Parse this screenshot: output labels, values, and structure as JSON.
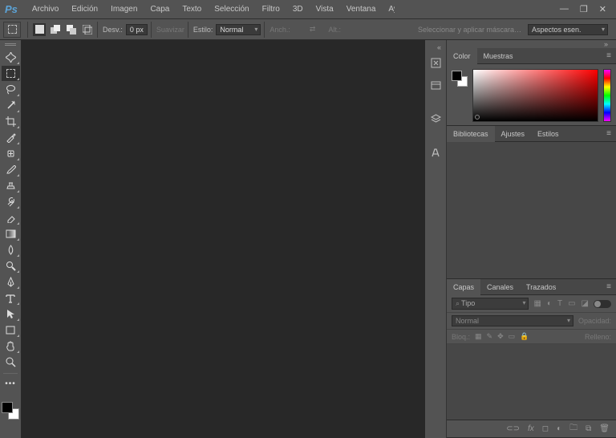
{
  "app": {
    "logo": "Ps"
  },
  "menu": [
    "Archivo",
    "Edición",
    "Imagen",
    "Capa",
    "Texto",
    "Selección",
    "Filtro",
    "3D",
    "Vista",
    "Ventana",
    "Ayuda"
  ],
  "win": {
    "min": "—",
    "max": "❐",
    "close": "✕"
  },
  "opt": {
    "desv": "Desv.:",
    "desv_val": "0 px",
    "suavizar": "Suavizar",
    "estilo": "Estilo:",
    "estilo_val": "Normal",
    "anch": "Anch.:",
    "alt": "Alt.:",
    "swap": "⇄",
    "refine": "Seleccionar y aplicar máscara…",
    "aspect": "Aspectos esen."
  },
  "colorPanel": {
    "tabs": [
      "Color",
      "Muestras"
    ]
  },
  "libPanel": {
    "tabs": [
      "Bibliotecas",
      "Ajustes",
      "Estilos"
    ]
  },
  "layersPanel": {
    "tabs": [
      "Capas",
      "Canales",
      "Trazados"
    ],
    "filter": "Tipo",
    "blend": "Normal",
    "opacity_lbl": "Opacidad:",
    "lock_lbl": "Bloq.:",
    "fill_lbl": "Relleno:"
  }
}
